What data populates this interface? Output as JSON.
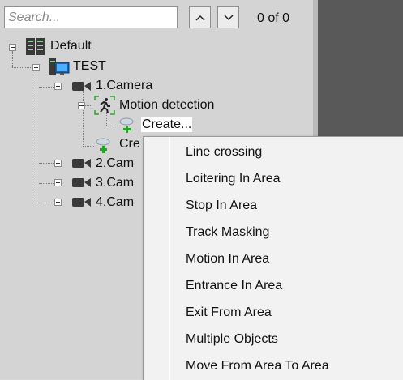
{
  "search": {
    "placeholder": "Search...",
    "value": ""
  },
  "navigation": {
    "counter": "0 of 0",
    "up_icon": "chevron-up-icon",
    "down_icon": "chevron-down-icon"
  },
  "tree": {
    "root": {
      "label": "Default",
      "icon": "server-icon"
    },
    "server": {
      "label": "TEST",
      "icon": "computer-icon"
    },
    "camera1": {
      "label": "1.Camera",
      "icon": "camera-icon"
    },
    "motion": {
      "label": "Motion detection",
      "icon": "motion-icon"
    },
    "create_child": {
      "label": "Create...",
      "icon": "create-icon"
    },
    "create_partial": {
      "label": "Cre",
      "icon": "create-icon"
    },
    "camera2": {
      "label": "2.Cam",
      "icon": "camera-icon"
    },
    "camera3": {
      "label": "3.Cam",
      "icon": "camera-icon"
    },
    "camera4": {
      "label": "4.Cam",
      "icon": "camera-icon"
    }
  },
  "context_menu": {
    "items": [
      {
        "label": "Line crossing"
      },
      {
        "label": "Loitering In Area"
      },
      {
        "label": "Stop In Area"
      },
      {
        "label": "Track Masking"
      },
      {
        "label": "Motion In Area"
      },
      {
        "label": "Entrance In Area"
      },
      {
        "label": "Exit From Area"
      },
      {
        "label": "Multiple Objects"
      },
      {
        "label": "Move From Area To Area"
      }
    ]
  },
  "colors": {
    "panel": "#d4d4d4",
    "right_panel": "#595959",
    "menu_bg": "#f2f2f2",
    "create_plus": "#1fa81f",
    "motion_bracket": "#2aa52a"
  }
}
